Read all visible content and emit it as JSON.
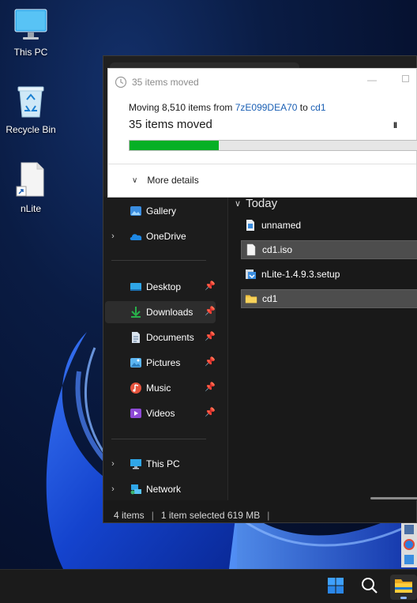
{
  "desktop": {
    "icons": [
      {
        "label": "This PC",
        "icon": "monitor-icon"
      },
      {
        "label": "Recycle Bin",
        "icon": "recycle-bin-icon"
      },
      {
        "label": "nLite",
        "icon": "shortcut-file-icon"
      }
    ]
  },
  "dialog": {
    "title": "35 items moved",
    "moving_prefix": "Moving 8,510 items from ",
    "source": "7zE099DEA70",
    "to_word": " to ",
    "destination": "cd1",
    "status": "35 items moved",
    "pause_glyph": "II",
    "progress_fraction": 0.31,
    "progress_color": "#06b025",
    "more_details": "More details"
  },
  "explorer": {
    "nav": {
      "items": [
        {
          "label": "Gallery",
          "icon": "gallery-icon",
          "chevron": "",
          "pinned": false
        },
        {
          "label": "OneDrive",
          "icon": "onedrive-cloud-icon",
          "chevron": "›",
          "pinned": false
        },
        {
          "label": "Desktop",
          "icon": "desktop-folder-icon",
          "chevron": "",
          "pinned": true
        },
        {
          "label": "Downloads",
          "icon": "downloads-icon",
          "chevron": "",
          "pinned": true,
          "selected": true
        },
        {
          "label": "Documents",
          "icon": "documents-icon",
          "chevron": "",
          "pinned": true
        },
        {
          "label": "Pictures",
          "icon": "pictures-icon",
          "chevron": "",
          "pinned": true
        },
        {
          "label": "Music",
          "icon": "music-icon",
          "chevron": "",
          "pinned": true
        },
        {
          "label": "Videos",
          "icon": "videos-icon",
          "chevron": "",
          "pinned": true
        },
        {
          "label": "This PC",
          "icon": "this-pc-icon",
          "chevron": "›",
          "pinned": false
        },
        {
          "label": "Network",
          "icon": "network-icon",
          "chevron": "›",
          "pinned": false
        }
      ],
      "pin_glyph": "📌"
    },
    "content": {
      "group": "Today",
      "files": [
        {
          "name": "unnamed",
          "icon": "image-file-icon",
          "selected": false
        },
        {
          "name": "cd1.iso",
          "icon": "iso-file-icon",
          "selected": true
        },
        {
          "name": "nLite-1.4.9.3.setup",
          "icon": "installer-icon",
          "selected": false
        },
        {
          "name": "cd1",
          "icon": "folder-icon",
          "selected": true
        }
      ]
    },
    "status": {
      "count": "4 items",
      "selection": "1 item selected  619 MB",
      "sep": "|"
    }
  },
  "taskbar": {
    "buttons": [
      {
        "name": "start",
        "icon": "windows-logo-icon"
      },
      {
        "name": "search",
        "icon": "search-icon"
      },
      {
        "name": "file-explorer",
        "icon": "file-explorer-icon",
        "active": true
      }
    ],
    "accent": "#0078d4"
  }
}
